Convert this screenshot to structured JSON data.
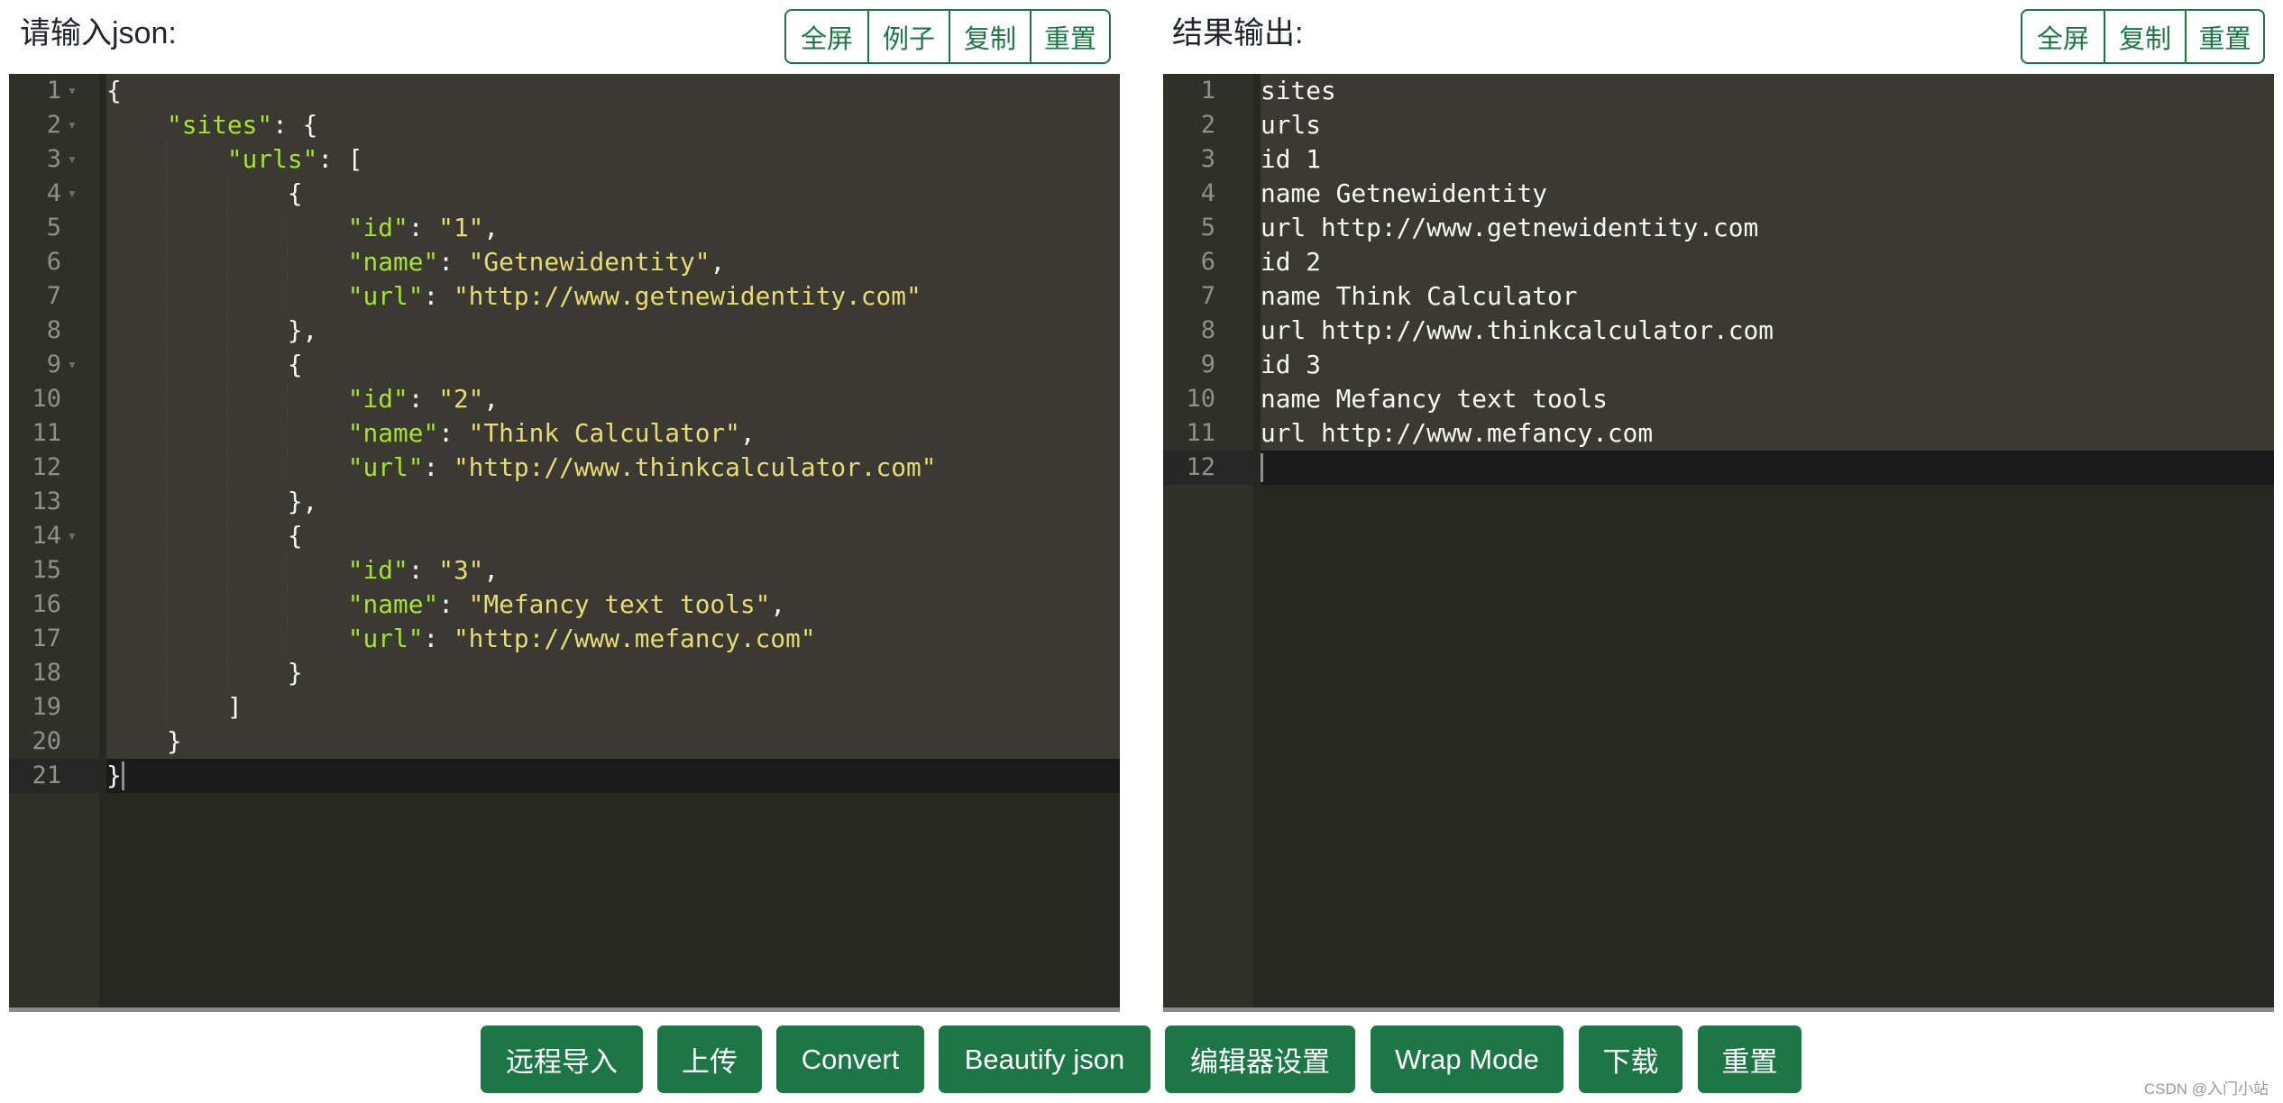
{
  "input_panel": {
    "title": "请输入json:",
    "buttons": [
      "全屏",
      "例子",
      "复制",
      "重置"
    ],
    "lines": [
      [
        {
          "t": "p",
          "v": "{"
        }
      ],
      [
        {
          "t": "p",
          "v": "    "
        },
        {
          "t": "k",
          "v": "\"sites\""
        },
        {
          "t": "p",
          "v": ": {"
        }
      ],
      [
        {
          "t": "p",
          "v": "        "
        },
        {
          "t": "k",
          "v": "\"urls\""
        },
        {
          "t": "p",
          "v": ": ["
        }
      ],
      [
        {
          "t": "p",
          "v": "            {"
        }
      ],
      [
        {
          "t": "p",
          "v": "                "
        },
        {
          "t": "k",
          "v": "\"id\""
        },
        {
          "t": "p",
          "v": ": "
        },
        {
          "t": "s",
          "v": "\"1\""
        },
        {
          "t": "p",
          "v": ","
        }
      ],
      [
        {
          "t": "p",
          "v": "                "
        },
        {
          "t": "k",
          "v": "\"name\""
        },
        {
          "t": "p",
          "v": ": "
        },
        {
          "t": "s",
          "v": "\"Getnewidentity\""
        },
        {
          "t": "p",
          "v": ","
        }
      ],
      [
        {
          "t": "p",
          "v": "                "
        },
        {
          "t": "k",
          "v": "\"url\""
        },
        {
          "t": "p",
          "v": ": "
        },
        {
          "t": "s",
          "v": "\"http://www.getnewidentity.com\""
        }
      ],
      [
        {
          "t": "p",
          "v": "            },"
        }
      ],
      [
        {
          "t": "p",
          "v": "            {"
        }
      ],
      [
        {
          "t": "p",
          "v": "                "
        },
        {
          "t": "k",
          "v": "\"id\""
        },
        {
          "t": "p",
          "v": ": "
        },
        {
          "t": "s",
          "v": "\"2\""
        },
        {
          "t": "p",
          "v": ","
        }
      ],
      [
        {
          "t": "p",
          "v": "                "
        },
        {
          "t": "k",
          "v": "\"name\""
        },
        {
          "t": "p",
          "v": ": "
        },
        {
          "t": "s",
          "v": "\"Think Calculator\""
        },
        {
          "t": "p",
          "v": ","
        }
      ],
      [
        {
          "t": "p",
          "v": "                "
        },
        {
          "t": "k",
          "v": "\"url\""
        },
        {
          "t": "p",
          "v": ": "
        },
        {
          "t": "s",
          "v": "\"http://www.thinkcalculator.com\""
        }
      ],
      [
        {
          "t": "p",
          "v": "            },"
        }
      ],
      [
        {
          "t": "p",
          "v": "            {"
        }
      ],
      [
        {
          "t": "p",
          "v": "                "
        },
        {
          "t": "k",
          "v": "\"id\""
        },
        {
          "t": "p",
          "v": ": "
        },
        {
          "t": "s",
          "v": "\"3\""
        },
        {
          "t": "p",
          "v": ","
        }
      ],
      [
        {
          "t": "p",
          "v": "                "
        },
        {
          "t": "k",
          "v": "\"name\""
        },
        {
          "t": "p",
          "v": ": "
        },
        {
          "t": "s",
          "v": "\"Mefancy text tools\""
        },
        {
          "t": "p",
          "v": ","
        }
      ],
      [
        {
          "t": "p",
          "v": "                "
        },
        {
          "t": "k",
          "v": "\"url\""
        },
        {
          "t": "p",
          "v": ": "
        },
        {
          "t": "s",
          "v": "\"http://www.mefancy.com\""
        }
      ],
      [
        {
          "t": "p",
          "v": "            }"
        }
      ],
      [
        {
          "t": "p",
          "v": "        ]"
        }
      ],
      [
        {
          "t": "p",
          "v": "    }"
        }
      ],
      [
        {
          "t": "p",
          "v": "}"
        }
      ]
    ],
    "fold_lines": [
      1,
      2,
      3,
      4,
      9,
      14
    ],
    "active_line": 21
  },
  "output_panel": {
    "title": "结果输出:",
    "buttons": [
      "全屏",
      "复制",
      "重置"
    ],
    "lines": [
      "sites",
      "urls",
      "id 1",
      "name Getnewidentity",
      "url http://www.getnewidentity.com",
      "id 2",
      "name Think Calculator",
      "url http://www.thinkcalculator.com",
      "id 3",
      "name Mefancy text tools",
      "url http://www.mefancy.com",
      ""
    ],
    "active_line": 12
  },
  "toolbar": {
    "buttons": [
      "远程导入",
      "上传",
      "Convert",
      "Beautify json",
      "编辑器设置",
      "Wrap Mode",
      "下载",
      "重置"
    ]
  },
  "watermark": "CSDN @入门小站",
  "colors": {
    "accent": "#1d7645",
    "editor_bg": "#272822",
    "key": "#a6e22e",
    "string": "#e6db74"
  }
}
